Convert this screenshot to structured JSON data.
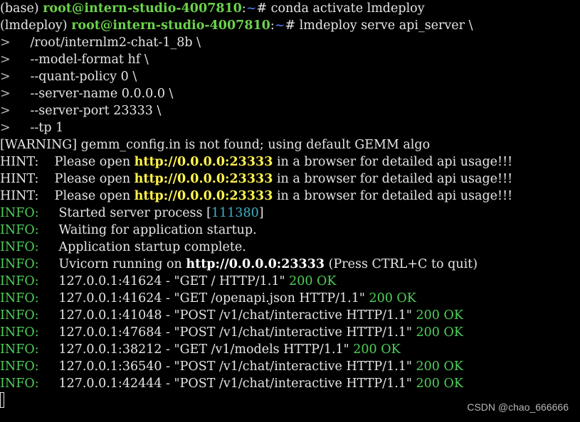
{
  "terminal": {
    "lines": {
      "l1": {
        "env": "(base) ",
        "user": "root@intern-studio-4007810",
        "colon": ":",
        "path": "~",
        "cmd": "# conda activate lmdeploy"
      },
      "l2": {
        "env": "(lmdeploy) ",
        "user": "root@intern-studio-4007810",
        "colon": ":",
        "path": "~",
        "cmd": "# lmdeploy serve api_server \\"
      },
      "l3": {
        "marker": ">",
        "text": "     /root/internlm2-chat-1_8b \\"
      },
      "l4": {
        "marker": ">",
        "text": "     --model-format hf \\"
      },
      "l5": {
        "marker": ">",
        "text": "     --quant-policy 0 \\"
      },
      "l6": {
        "marker": ">",
        "text": "     --server-name 0.0.0.0 \\"
      },
      "l7": {
        "marker": ">",
        "text": "     --server-port 23333 \\"
      },
      "l8": {
        "marker": ">",
        "text": "     --tp 1"
      },
      "l9": {
        "text": "[WARNING] gemm_config.in is not found; using default GEMM algo"
      },
      "hint1": {
        "label": "HINT:    Please open ",
        "url": "http://0.0.0.0:23333",
        "rest": " in a browser for detailed api usage!!!"
      },
      "hint2": {
        "label": "HINT:    Please open ",
        "url": "http://0.0.0.0:23333",
        "rest": " in a browser for detailed api usage!!!"
      },
      "hint3": {
        "label": "HINT:    Please open ",
        "url": "http://0.0.0.0:23333",
        "rest": " in a browser for detailed api usage!!!"
      },
      "info1": {
        "label": "INFO:",
        "text": "     Started server process [",
        "pid": "111380",
        "close": "]"
      },
      "info2": {
        "label": "INFO:",
        "text": "     Waiting for application startup."
      },
      "info3": {
        "label": "INFO:",
        "text": "     Application startup complete."
      },
      "info4": {
        "label": "INFO:",
        "text": "     Uvicorn running on ",
        "url": "http://0.0.0.0:23333",
        "rest": " (Press CTRL+C to quit)"
      },
      "req1": {
        "label": "INFO:",
        "text": "     127.0.0.1:41624 - ",
        "req": "\"GET / HTTP/1.1\"",
        "status": " 200 OK"
      },
      "req2": {
        "label": "INFO:",
        "text": "     127.0.0.1:41624 - ",
        "req": "\"GET /openapi.json HTTP/1.1\"",
        "status": " 200 OK"
      },
      "req3": {
        "label": "INFO:",
        "text": "     127.0.0.1:41048 - ",
        "req": "\"POST /v1/chat/interactive HTTP/1.1\"",
        "status": " 200 OK"
      },
      "req4": {
        "label": "INFO:",
        "text": "     127.0.0.1:47684 - ",
        "req": "\"POST /v1/chat/interactive HTTP/1.1\"",
        "status": " 200 OK"
      },
      "req5": {
        "label": "INFO:",
        "text": "     127.0.0.1:38212 - ",
        "req": "\"GET /v1/models HTTP/1.1\"",
        "status": " 200 OK"
      },
      "req6": {
        "label": "INFO:",
        "text": "     127.0.0.1:36540 - ",
        "req": "\"POST /v1/chat/interactive HTTP/1.1\"",
        "status": " 200 OK"
      },
      "req7": {
        "label": "INFO:",
        "text": "     127.0.0.1:42444 - ",
        "req": "\"POST /v1/chat/interactive HTTP/1.1\"",
        "status": " 200 OK"
      }
    }
  },
  "watermark": "CSDN @chao_666666",
  "colors": {
    "background": "#000000",
    "prompt_user": "#6bd24b",
    "url_yellow": "#fff34d",
    "info_green": "#4fd05a",
    "pid_cyan": "#3db3c7"
  }
}
